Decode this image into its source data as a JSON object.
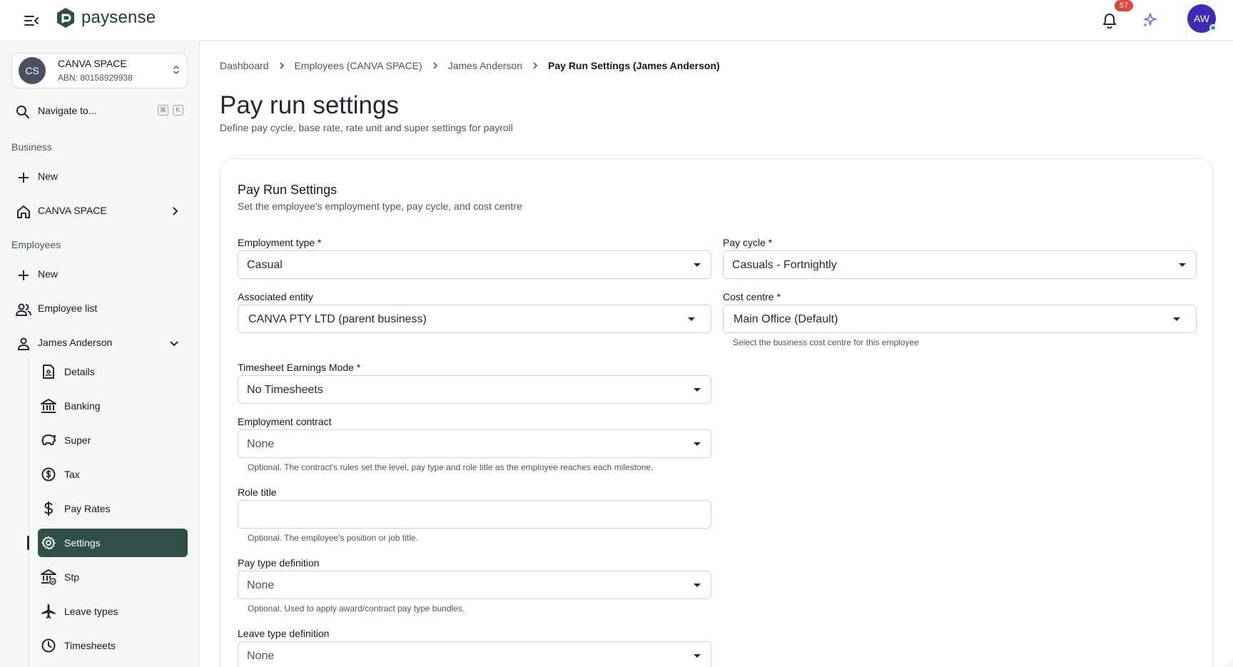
{
  "app": {
    "brand": "paysense",
    "notification_count": "57",
    "user_initials": "AW",
    "colors": {
      "accent": "#2f4f47",
      "avatar": "#3b2bb5",
      "badge": "#e0463a",
      "sparkle": "#7c5cff"
    }
  },
  "sidebar": {
    "org": {
      "initials": "CS",
      "name": "CANVA SPACE",
      "abn": "ABN: 80158929938"
    },
    "search": {
      "label": "Navigate to...",
      "key1": "⌘",
      "key2": "K"
    },
    "business_label": "Business",
    "business_new": "New",
    "business_item": "CANVA SPACE",
    "employees_label": "Employees",
    "employees_new": "New",
    "employee_list": "Employee list",
    "employee_name": "James Anderson",
    "sub_items": {
      "details": "Details",
      "banking": "Banking",
      "super": "Super",
      "tax": "Tax",
      "pay_rates": "Pay Rates",
      "settings": "Settings",
      "stp": "Stp",
      "leave_types": "Leave types",
      "timesheets": "Timesheets"
    },
    "icons": [
      "search-icon",
      "plus-icon",
      "home-icon",
      "people-icon",
      "person-icon",
      "document-icon",
      "bank-icon",
      "piggy-bank-icon",
      "dollar-circle-icon",
      "dollar-icon",
      "gear-icon",
      "bank-check-icon",
      "airplane-icon",
      "clock-icon"
    ]
  },
  "breadcrumb": {
    "c1": "Dashboard",
    "c2": "Employees (CANVA SPACE)",
    "c3": "James Anderson",
    "c4": "Pay Run Settings (James Anderson)"
  },
  "page": {
    "title": "Pay run settings",
    "subtitle": "Define pay cycle, base rate, rate unit and super settings for payroll"
  },
  "card": {
    "title": "Pay Run Settings",
    "subtitle": "Set the employee's employment type, pay cycle, and cost centre"
  },
  "form": {
    "employment_type": {
      "label": "Employment type *",
      "value": "Casual"
    },
    "pay_cycle": {
      "label": "Pay cycle *",
      "value": "Casuals - Fortnightly"
    },
    "associated_entity": {
      "label": "Associated entity",
      "value": "CANVA PTY LTD (parent business)"
    },
    "cost_centre": {
      "label": "Cost centre *",
      "value": "Main Office (Default)",
      "helper": "Select the business cost centre for this employee"
    },
    "timesheet_mode": {
      "label": "Timesheet Earnings Mode *",
      "value": "No Timesheets"
    },
    "employment_contract": {
      "label": "Employment contract",
      "value": "None",
      "helper": "Optional. The contract's rules set the level, pay type and role title as the employee reaches each milestone."
    },
    "role_title": {
      "label": "Role title",
      "value": "",
      "helper": "Optional. The employee's position or job title."
    },
    "pay_type_definition": {
      "label": "Pay type definition",
      "value": "None",
      "helper": "Optional. Used to apply award/contract pay type bundles."
    },
    "leave_type_definition": {
      "label": "Leave type definition",
      "value": "None"
    }
  }
}
